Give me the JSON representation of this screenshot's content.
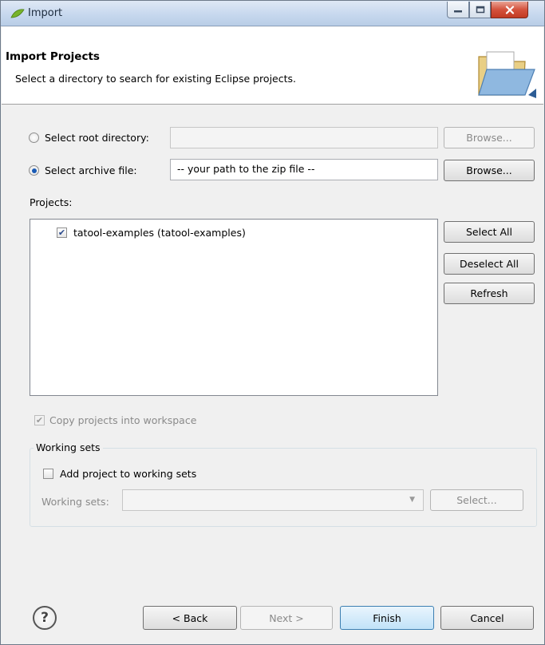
{
  "window": {
    "title": "Import",
    "controls": [
      "minimize",
      "maximize",
      "close"
    ]
  },
  "header": {
    "title": "Import Projects",
    "description": "Select a directory to search for existing Eclipse projects."
  },
  "source": {
    "root_directory": {
      "label": "Select root directory:",
      "selected": false,
      "value": "",
      "browse_label": "Browse...",
      "enabled": false
    },
    "archive_file": {
      "label": "Select archive file:",
      "selected": true,
      "value": "-- your path to the zip file --",
      "browse_label": "Browse...",
      "enabled": true
    }
  },
  "projects": {
    "label": "Projects:",
    "items": [
      {
        "label": "tatool-examples (tatool-examples)",
        "checked": true
      }
    ],
    "buttons": {
      "select_all": "Select All",
      "deselect_all": "Deselect All",
      "refresh": "Refresh"
    }
  },
  "options": {
    "copy_into_workspace": {
      "label": "Copy projects into workspace",
      "checked": true,
      "enabled": false
    }
  },
  "working_sets": {
    "legend": "Working sets",
    "add_label": "Add project to working sets",
    "add_checked": false,
    "combo_label": "Working sets:",
    "combo_value": "",
    "select_label": "Select..."
  },
  "footer": {
    "help_icon": "?",
    "back": "< Back",
    "next": "Next >",
    "finish": "Finish",
    "cancel": "Cancel"
  },
  "colors": {
    "window_bg": "#f0f0f0",
    "header_bg": "#ffffff",
    "primary_button": "#c1e2f8",
    "close_button": "#c23a22"
  }
}
